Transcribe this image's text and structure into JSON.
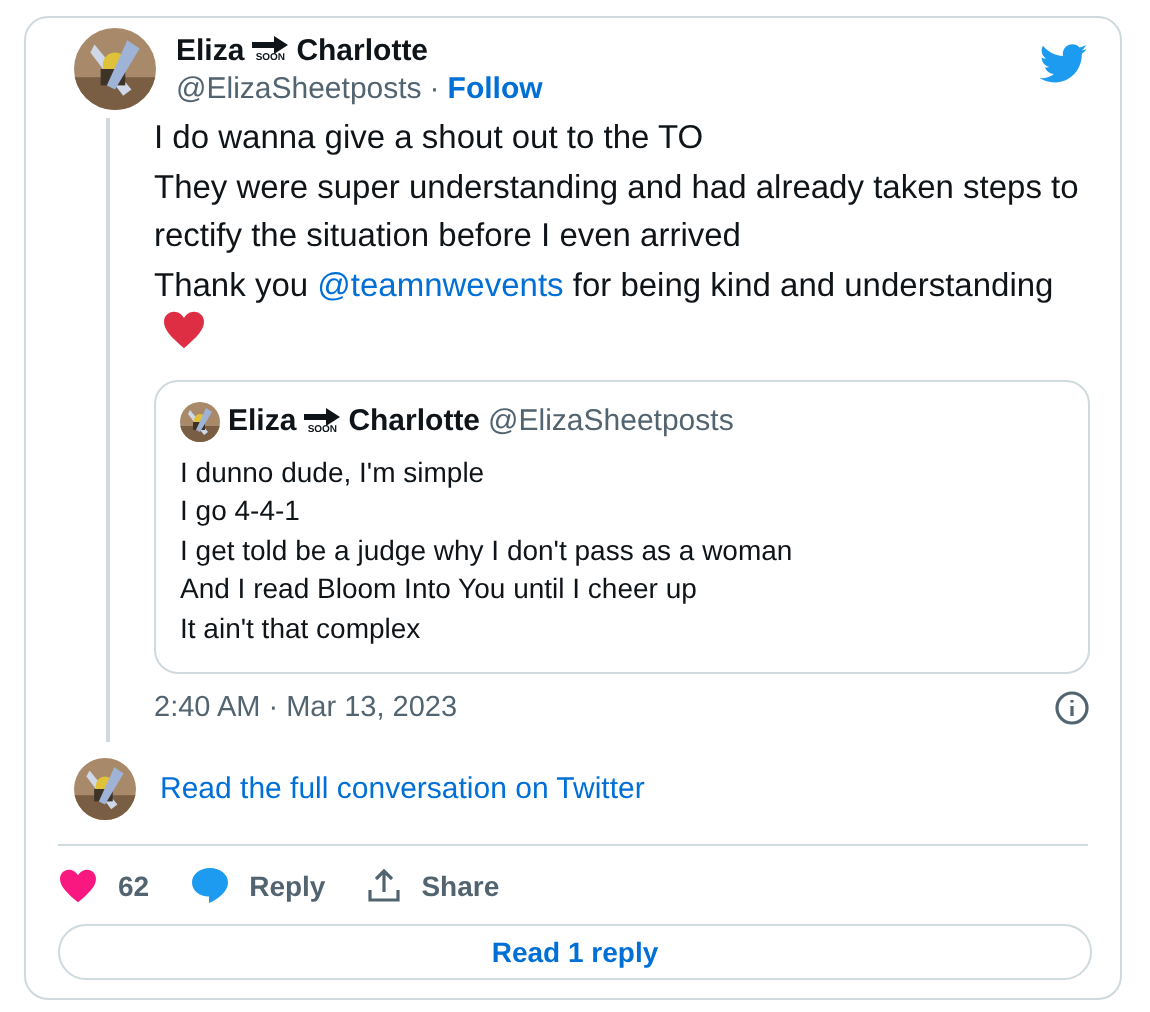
{
  "author": {
    "name_first": "Eliza",
    "emoji_caption": "SOON",
    "name_last": "Charlotte",
    "handle": "@ElizaSheetposts",
    "separator": "·",
    "follow": "Follow"
  },
  "body": [
    {
      "text": "I do wanna give a shout out to the TO"
    },
    {
      "text": "They were super understanding and had already taken steps to rectify the situation before I even arrived"
    },
    {
      "text": "Thank you ",
      "link": "@teamnwevents",
      "after": " for being kind and understanding",
      "heart": true
    }
  ],
  "quote": {
    "name_first": "Eliza",
    "emoji_caption": "SOON",
    "name_last": "Charlotte",
    "handle": "@ElizaSheetposts",
    "lines": [
      "I dunno dude, I'm simple",
      "I go 4-4-1",
      "I get told be a judge why I don't pass as a woman",
      "And I read Bloom Into You until I cheer up",
      "It ain't that complex"
    ]
  },
  "timestamp": "2:40 AM · Mar 13, 2023",
  "conversation_link": "Read the full conversation on Twitter",
  "actions": [
    {
      "kind": "like",
      "label": "62"
    },
    {
      "kind": "reply",
      "label": "Reply"
    },
    {
      "kind": "share",
      "label": "Share"
    }
  ],
  "read_replies": "Read 1 reply"
}
